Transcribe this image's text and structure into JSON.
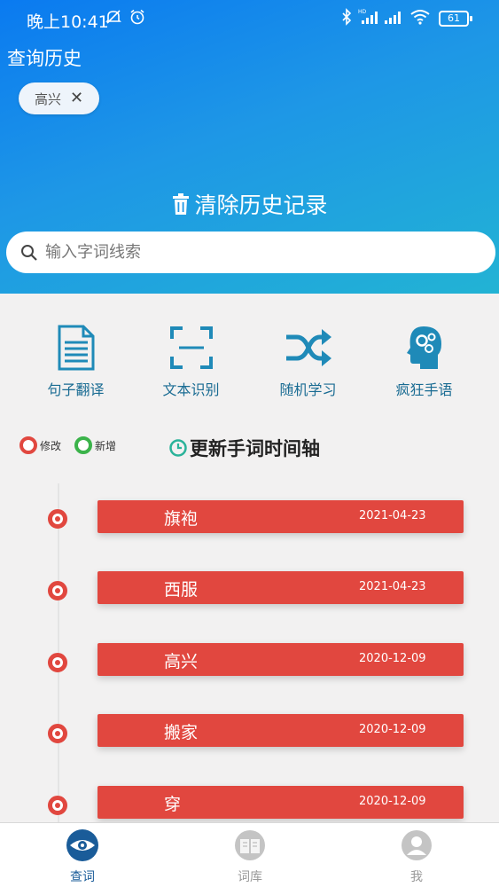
{
  "status_bar": {
    "time": "晚上10:41",
    "battery": "61"
  },
  "history": {
    "title": "查询历史",
    "chips": [
      "高兴"
    ],
    "clear_label": "清除历史记录"
  },
  "search": {
    "placeholder": "输入字词线索"
  },
  "features": [
    {
      "label": "句子翻译",
      "icon": "document-icon"
    },
    {
      "label": "文本识别",
      "icon": "scan-icon"
    },
    {
      "label": "随机学习",
      "icon": "shuffle-icon"
    },
    {
      "label": "疯狂手语",
      "icon": "brain-gear-icon"
    }
  ],
  "legend": {
    "modified": "修改",
    "added": "新增"
  },
  "timeline": {
    "title": "更新手词时间轴",
    "items": [
      {
        "word": "旗袍",
        "date": "2021-04-23"
      },
      {
        "word": "西服",
        "date": "2021-04-23"
      },
      {
        "word": "高兴",
        "date": "2020-12-09"
      },
      {
        "word": "搬家",
        "date": "2020-12-09"
      },
      {
        "word": "穿",
        "date": "2020-12-09"
      }
    ]
  },
  "tabs": [
    {
      "label": "查词",
      "icon": "eye-icon",
      "active": true
    },
    {
      "label": "词库",
      "icon": "book-icon",
      "active": false
    },
    {
      "label": "我",
      "icon": "user-icon",
      "active": false
    }
  ],
  "colors": {
    "accent": "#e1473f",
    "hero_start": "#0a7af0",
    "hero_end": "#22b3d4",
    "feature_icon": "#1f8ab8",
    "active_tab": "#1a5c99",
    "added_green": "#3bb34a"
  }
}
